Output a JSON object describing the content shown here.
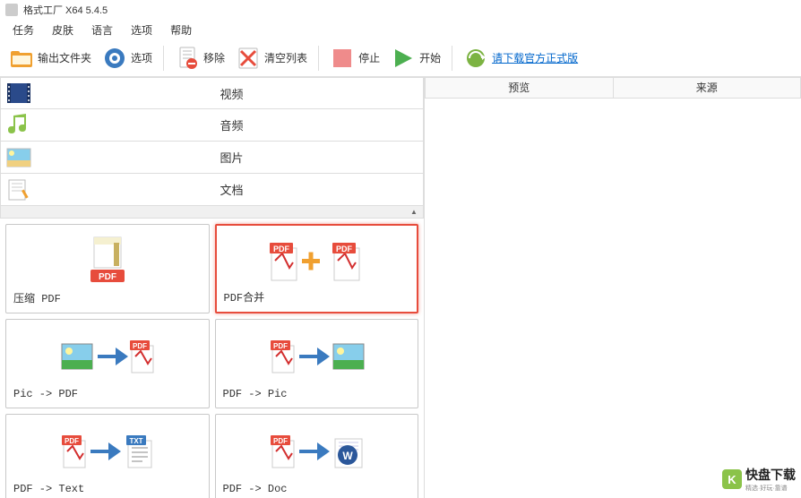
{
  "titlebar": {
    "title": "格式工厂 X64 5.4.5"
  },
  "menubar": {
    "task": "任务",
    "skin": "皮肤",
    "language": "语言",
    "options": "选项",
    "help": "帮助"
  },
  "toolbar": {
    "output_folder": "输出文件夹",
    "options": "选项",
    "remove": "移除",
    "clear_list": "清空列表",
    "stop": "停止",
    "start": "开始",
    "download_link": "请下载官方正式版"
  },
  "categories": {
    "video": "视频",
    "audio": "音频",
    "image": "图片",
    "document": "文档"
  },
  "tools": [
    {
      "label": "压缩 PDF"
    },
    {
      "label": "PDF合并"
    },
    {
      "label": "Pic -> PDF"
    },
    {
      "label": "PDF -> Pic"
    },
    {
      "label": "PDF -> Text"
    },
    {
      "label": "PDF -> Doc"
    }
  ],
  "right_panel": {
    "preview": "预览",
    "source": "来源"
  },
  "watermark": {
    "text": "快盘下载",
    "sub": "精选·好玩·靠谱"
  },
  "colors": {
    "highlight": "#e74c3c",
    "pdf_red": "#d32f2f",
    "link_blue": "#0066cc"
  }
}
